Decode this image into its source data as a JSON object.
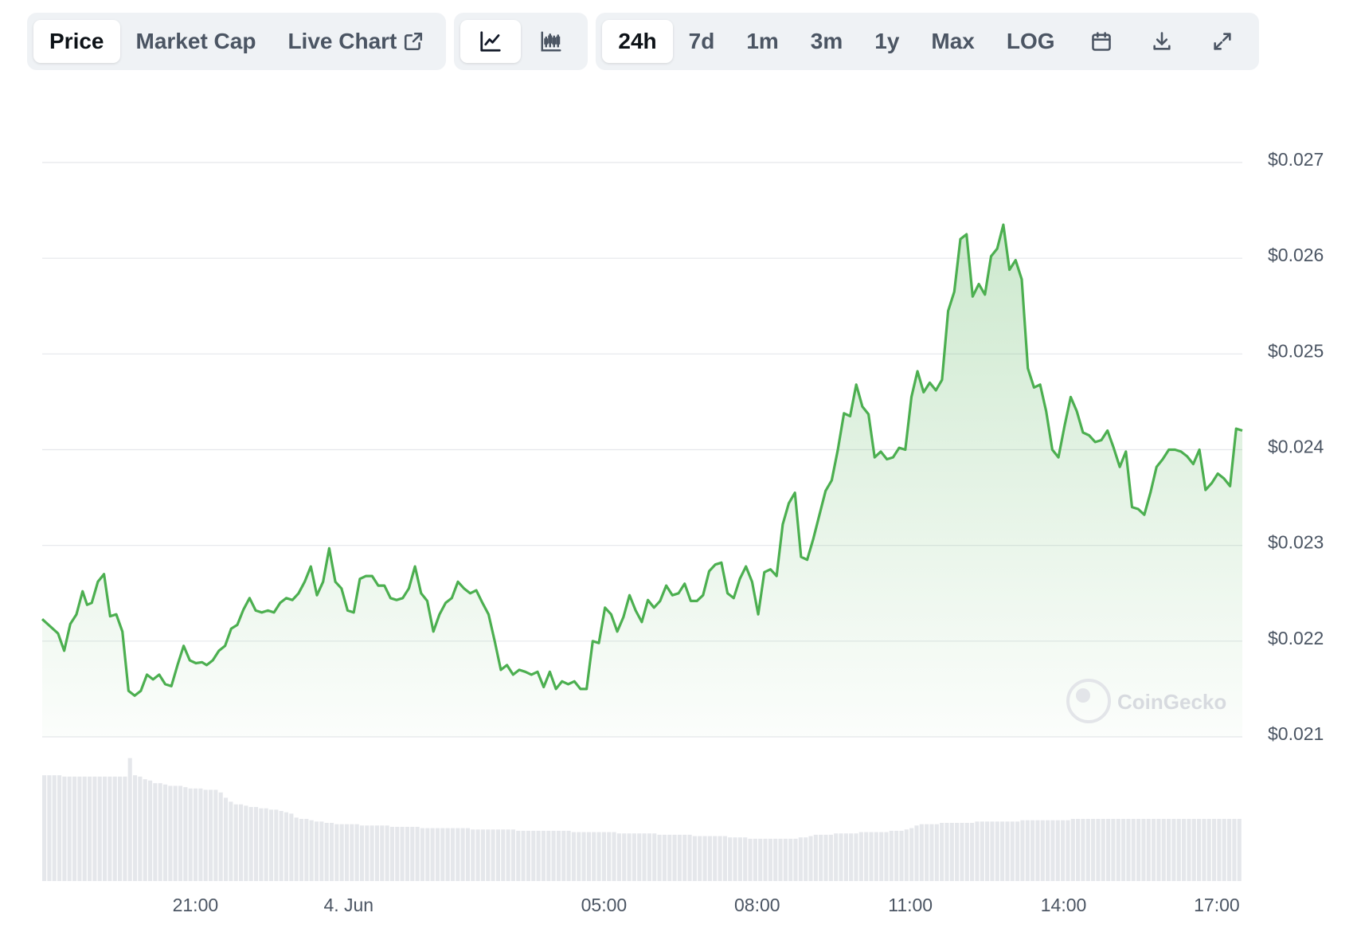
{
  "toolbar": {
    "tabs": [
      {
        "label": "Price",
        "active": true
      },
      {
        "label": "Market Cap",
        "active": false
      },
      {
        "label": "Live Chart",
        "active": false
      }
    ],
    "chart_style_icons": [
      "line-chart-icon",
      "candlestick-icon"
    ],
    "ranges": [
      {
        "label": "24h",
        "active": true
      },
      {
        "label": "7d",
        "active": false
      },
      {
        "label": "1m",
        "active": false
      },
      {
        "label": "3m",
        "active": false
      },
      {
        "label": "1y",
        "active": false
      },
      {
        "label": "Max",
        "active": false
      },
      {
        "label": "LOG",
        "active": false
      }
    ],
    "tool_icons": [
      "calendar-icon",
      "download-icon",
      "expand-icon"
    ]
  },
  "watermark": "CoinGecko",
  "colors": {
    "line": "#4caf50",
    "grid": "#e5e7eb",
    "volume": "#e5e7eb",
    "accent_text": "#0d1217"
  },
  "chart_data": {
    "type": "area",
    "title": "",
    "xlabel": "",
    "ylabel": "",
    "ylim": [
      0.021,
      0.027
    ],
    "y_ticks": [
      0.021,
      0.022,
      0.023,
      0.024,
      0.025,
      0.026,
      0.027
    ],
    "y_tick_labels": [
      "$0.021",
      "$0.022",
      "$0.023",
      "$0.024",
      "$0.025",
      "$0.026",
      "$0.027"
    ],
    "x_range_hours": [
      18.0,
      41.5
    ],
    "x_ticks": [
      {
        "label": "21:00",
        "hour": 21
      },
      {
        "label": "4. Jun",
        "hour": 24
      },
      {
        "label": "05:00",
        "hour": 29
      },
      {
        "label": "08:00",
        "hour": 32
      },
      {
        "label": "11:00",
        "hour": 35
      },
      {
        "label": "14:00",
        "hour": 38
      },
      {
        "label": "17:00",
        "hour": 41
      }
    ],
    "grid": true,
    "series": [
      {
        "points": [
          [
            18.0,
            0.02223
          ],
          [
            18.31,
            0.02208
          ],
          [
            18.43,
            0.0219
          ],
          [
            18.55,
            0.02218
          ],
          [
            18.67,
            0.02228
          ],
          [
            18.79,
            0.02252
          ],
          [
            18.88,
            0.02238
          ],
          [
            18.97,
            0.0224
          ],
          [
            19.09,
            0.02262
          ],
          [
            19.21,
            0.0227
          ],
          [
            19.33,
            0.02226
          ],
          [
            19.45,
            0.02228
          ],
          [
            19.57,
            0.0221
          ],
          [
            19.69,
            0.02148
          ],
          [
            19.81,
            0.02143
          ],
          [
            19.93,
            0.02148
          ],
          [
            20.05,
            0.02165
          ],
          [
            20.17,
            0.0216
          ],
          [
            20.29,
            0.02165
          ],
          [
            20.41,
            0.02155
          ],
          [
            20.53,
            0.02153
          ],
          [
            20.65,
            0.02175
          ],
          [
            20.77,
            0.02195
          ],
          [
            20.89,
            0.0218
          ],
          [
            21.01,
            0.02177
          ],
          [
            21.13,
            0.02178
          ],
          [
            21.22,
            0.02175
          ],
          [
            21.34,
            0.0218
          ],
          [
            21.46,
            0.0219
          ],
          [
            21.58,
            0.02195
          ],
          [
            21.7,
            0.02213
          ],
          [
            21.82,
            0.02217
          ],
          [
            21.94,
            0.02233
          ],
          [
            22.06,
            0.02245
          ],
          [
            22.18,
            0.02232
          ],
          [
            22.3,
            0.0223
          ],
          [
            22.42,
            0.02232
          ],
          [
            22.54,
            0.0223
          ],
          [
            22.66,
            0.0224
          ],
          [
            22.78,
            0.02245
          ],
          [
            22.9,
            0.02243
          ],
          [
            23.02,
            0.0225
          ],
          [
            23.14,
            0.02262
          ],
          [
            23.26,
            0.02278
          ],
          [
            23.38,
            0.02248
          ],
          [
            23.5,
            0.02262
          ],
          [
            23.62,
            0.02297
          ],
          [
            23.74,
            0.02262
          ],
          [
            23.86,
            0.02255
          ],
          [
            23.98,
            0.02232
          ],
          [
            24.1,
            0.0223
          ],
          [
            24.22,
            0.02265
          ],
          [
            24.34,
            0.02268
          ],
          [
            24.46,
            0.02268
          ],
          [
            24.58,
            0.02258
          ],
          [
            24.7,
            0.02258
          ],
          [
            24.82,
            0.02245
          ],
          [
            24.94,
            0.02243
          ],
          [
            25.06,
            0.02245
          ],
          [
            25.18,
            0.02255
          ],
          [
            25.3,
            0.02278
          ],
          [
            25.42,
            0.0225
          ],
          [
            25.54,
            0.02242
          ],
          [
            25.66,
            0.0221
          ],
          [
            25.78,
            0.02228
          ],
          [
            25.9,
            0.0224
          ],
          [
            26.02,
            0.02245
          ],
          [
            26.14,
            0.02262
          ],
          [
            26.26,
            0.02255
          ],
          [
            26.38,
            0.0225
          ],
          [
            26.5,
            0.02253
          ],
          [
            26.62,
            0.0224
          ],
          [
            26.74,
            0.02228
          ],
          [
            26.86,
            0.022
          ],
          [
            26.98,
            0.0217
          ],
          [
            27.1,
            0.02175
          ],
          [
            27.22,
            0.02165
          ],
          [
            27.34,
            0.0217
          ],
          [
            27.46,
            0.02168
          ],
          [
            27.58,
            0.02165
          ],
          [
            27.7,
            0.02168
          ],
          [
            27.82,
            0.02152
          ],
          [
            27.94,
            0.02168
          ],
          [
            28.06,
            0.0215
          ],
          [
            28.18,
            0.02158
          ],
          [
            28.3,
            0.02155
          ],
          [
            28.42,
            0.02158
          ],
          [
            28.54,
            0.0215
          ],
          [
            28.66,
            0.0215
          ],
          [
            28.78,
            0.022
          ],
          [
            28.9,
            0.02198
          ],
          [
            29.02,
            0.02235
          ],
          [
            29.14,
            0.02228
          ],
          [
            29.26,
            0.0221
          ],
          [
            29.38,
            0.02225
          ],
          [
            29.5,
            0.02248
          ],
          [
            29.62,
            0.02232
          ],
          [
            29.74,
            0.0222
          ],
          [
            29.86,
            0.02243
          ],
          [
            29.98,
            0.02235
          ],
          [
            30.1,
            0.02242
          ],
          [
            30.22,
            0.02258
          ],
          [
            30.34,
            0.02248
          ],
          [
            30.46,
            0.0225
          ],
          [
            30.58,
            0.0226
          ],
          [
            30.7,
            0.02242
          ],
          [
            30.82,
            0.02242
          ],
          [
            30.94,
            0.02248
          ],
          [
            31.06,
            0.02273
          ],
          [
            31.18,
            0.0228
          ],
          [
            31.3,
            0.02282
          ],
          [
            31.42,
            0.0225
          ],
          [
            31.54,
            0.02245
          ],
          [
            31.66,
            0.02265
          ],
          [
            31.78,
            0.02278
          ],
          [
            31.9,
            0.02262
          ],
          [
            32.02,
            0.02228
          ],
          [
            32.14,
            0.02272
          ],
          [
            32.26,
            0.02275
          ],
          [
            32.38,
            0.02268
          ],
          [
            32.5,
            0.02322
          ],
          [
            32.62,
            0.02344
          ],
          [
            32.74,
            0.02355
          ],
          [
            32.86,
            0.02288
          ],
          [
            32.98,
            0.02285
          ],
          [
            33.1,
            0.02307
          ],
          [
            33.22,
            0.02332
          ],
          [
            33.34,
            0.02357
          ],
          [
            33.46,
            0.02368
          ],
          [
            33.58,
            0.024
          ],
          [
            33.7,
            0.02438
          ],
          [
            33.82,
            0.02435
          ],
          [
            33.94,
            0.02468
          ],
          [
            34.06,
            0.02445
          ],
          [
            34.18,
            0.02437
          ],
          [
            34.3,
            0.02392
          ],
          [
            34.42,
            0.02398
          ],
          [
            34.54,
            0.0239
          ],
          [
            34.66,
            0.02392
          ],
          [
            34.78,
            0.02402
          ],
          [
            34.9,
            0.024
          ],
          [
            35.02,
            0.02455
          ],
          [
            35.14,
            0.02482
          ],
          [
            35.26,
            0.0246
          ],
          [
            35.38,
            0.0247
          ],
          [
            35.5,
            0.02462
          ],
          [
            35.62,
            0.02473
          ],
          [
            35.74,
            0.02545
          ],
          [
            35.86,
            0.02565
          ],
          [
            35.98,
            0.0262
          ],
          [
            36.1,
            0.02625
          ],
          [
            36.22,
            0.0256
          ],
          [
            36.34,
            0.02573
          ],
          [
            36.46,
            0.02562
          ],
          [
            36.58,
            0.02602
          ],
          [
            36.7,
            0.0261
          ],
          [
            36.82,
            0.02635
          ],
          [
            36.94,
            0.02588
          ],
          [
            37.06,
            0.02598
          ],
          [
            37.18,
            0.02578
          ],
          [
            37.3,
            0.02485
          ],
          [
            37.42,
            0.02465
          ],
          [
            37.54,
            0.02468
          ],
          [
            37.66,
            0.0244
          ],
          [
            37.78,
            0.024
          ],
          [
            37.9,
            0.02392
          ],
          [
            38.02,
            0.02425
          ],
          [
            38.14,
            0.02455
          ],
          [
            38.26,
            0.0244
          ],
          [
            38.38,
            0.02418
          ],
          [
            38.5,
            0.02415
          ],
          [
            38.62,
            0.02408
          ],
          [
            38.74,
            0.0241
          ],
          [
            38.86,
            0.0242
          ],
          [
            38.98,
            0.02402
          ],
          [
            39.1,
            0.02382
          ],
          [
            39.22,
            0.02398
          ],
          [
            39.34,
            0.0234
          ],
          [
            39.46,
            0.02338
          ],
          [
            39.58,
            0.02332
          ],
          [
            39.7,
            0.02355
          ],
          [
            39.82,
            0.02382
          ],
          [
            39.94,
            0.0239
          ],
          [
            40.06,
            0.024
          ],
          [
            40.18,
            0.024
          ],
          [
            40.3,
            0.02398
          ],
          [
            40.42,
            0.02393
          ],
          [
            40.54,
            0.02385
          ],
          [
            40.66,
            0.024
          ],
          [
            40.78,
            0.02358
          ],
          [
            40.9,
            0.02365
          ],
          [
            41.02,
            0.02375
          ],
          [
            41.14,
            0.0237
          ],
          [
            41.26,
            0.02362
          ],
          [
            41.38,
            0.02422
          ],
          [
            41.5,
            0.0242
          ]
        ]
      }
    ],
    "volume_relative": [
      0.8,
      0.8,
      0.8,
      0.8,
      0.79,
      0.79,
      0.79,
      0.79,
      0.79,
      0.79,
      0.79,
      0.79,
      0.79,
      0.79,
      0.79,
      0.79,
      0.79,
      0.93,
      0.8,
      0.79,
      0.77,
      0.76,
      0.74,
      0.74,
      0.73,
      0.72,
      0.72,
      0.72,
      0.71,
      0.7,
      0.7,
      0.7,
      0.69,
      0.69,
      0.69,
      0.67,
      0.63,
      0.6,
      0.58,
      0.58,
      0.57,
      0.56,
      0.56,
      0.55,
      0.55,
      0.54,
      0.54,
      0.53,
      0.52,
      0.51,
      0.48,
      0.47,
      0.47,
      0.46,
      0.45,
      0.45,
      0.44,
      0.44,
      0.43,
      0.43,
      0.43,
      0.43,
      0.43,
      0.42,
      0.42,
      0.42,
      0.42,
      0.42,
      0.42,
      0.41,
      0.41,
      0.41,
      0.41,
      0.41,
      0.41,
      0.4,
      0.4,
      0.4,
      0.4,
      0.4,
      0.4,
      0.4,
      0.4,
      0.4,
      0.4,
      0.39,
      0.39,
      0.39,
      0.39,
      0.39,
      0.39,
      0.39,
      0.39,
      0.39,
      0.38,
      0.38,
      0.38,
      0.38,
      0.38,
      0.38,
      0.38,
      0.38,
      0.38,
      0.38,
      0.38,
      0.37,
      0.37,
      0.37,
      0.37,
      0.37,
      0.37,
      0.37,
      0.37,
      0.37,
      0.36,
      0.36,
      0.36,
      0.36,
      0.36,
      0.36,
      0.36,
      0.36,
      0.35,
      0.35,
      0.35,
      0.35,
      0.35,
      0.35,
      0.35,
      0.34,
      0.34,
      0.34,
      0.34,
      0.34,
      0.34,
      0.34,
      0.33,
      0.33,
      0.33,
      0.33,
      0.32,
      0.32,
      0.32,
      0.32,
      0.32,
      0.32,
      0.32,
      0.32,
      0.32,
      0.32,
      0.33,
      0.33,
      0.34,
      0.35,
      0.35,
      0.35,
      0.35,
      0.36,
      0.36,
      0.36,
      0.36,
      0.36,
      0.37,
      0.37,
      0.37,
      0.37,
      0.37,
      0.37,
      0.38,
      0.38,
      0.38,
      0.39,
      0.4,
      0.42,
      0.43,
      0.43,
      0.43,
      0.43,
      0.44,
      0.44,
      0.44,
      0.44,
      0.44,
      0.44,
      0.44,
      0.45,
      0.45,
      0.45,
      0.45,
      0.45,
      0.45,
      0.45,
      0.45,
      0.45,
      0.46,
      0.46,
      0.46,
      0.46,
      0.46,
      0.46,
      0.46,
      0.46,
      0.46,
      0.46,
      0.47,
      0.47,
      0.47,
      0.47,
      0.47,
      0.47,
      0.47,
      0.47,
      0.47,
      0.47,
      0.47,
      0.47,
      0.47,
      0.47,
      0.47,
      0.47,
      0.47,
      0.47,
      0.47,
      0.47,
      0.47,
      0.47,
      0.47,
      0.47,
      0.47,
      0.47,
      0.47,
      0.47,
      0.47,
      0.47,
      0.47,
      0.47,
      0.47,
      0.47
    ]
  }
}
